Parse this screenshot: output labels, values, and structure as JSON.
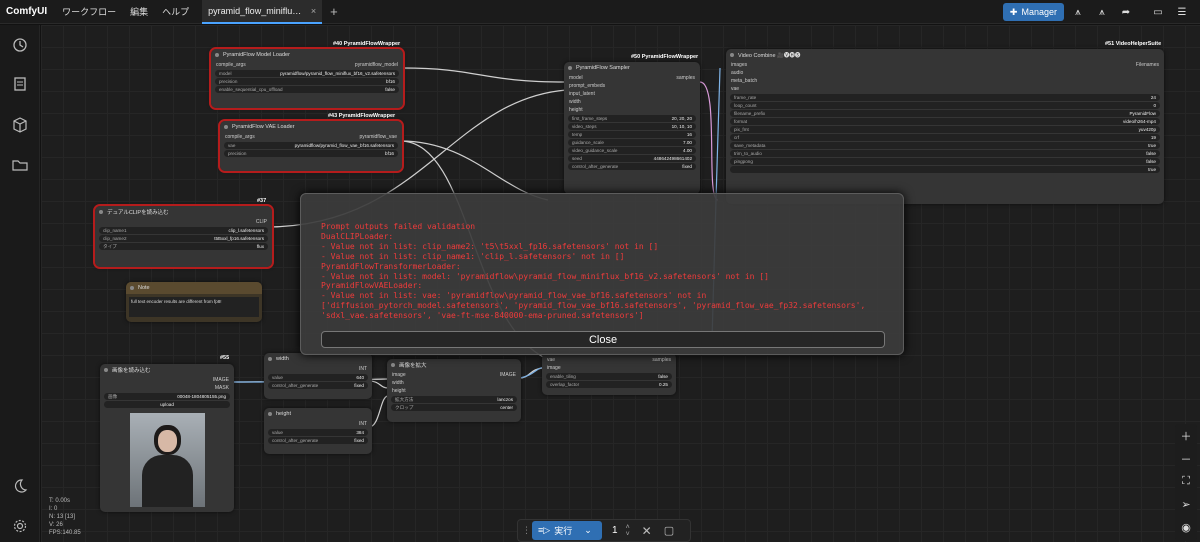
{
  "app": {
    "brand": "ComfyUI"
  },
  "menu": [
    "ワークフロー",
    "編集",
    "ヘルプ"
  ],
  "tab": {
    "label": "pyramid_flow_miniflu…",
    "close": "×",
    "new": "+"
  },
  "topright": {
    "manager_label": "Manager"
  },
  "nodes": {
    "model_loader": {
      "tag": "#40 PyramidFlowWrapper",
      "title": "PyramidFlow Model Loader",
      "in": "compile_args",
      "out": "pyramidflow_model",
      "widgets": [
        [
          "model",
          "pyramidflow/pyramid_flow_miniflux_bf16_v2.safetensors"
        ],
        [
          "precision",
          "bf16"
        ],
        [
          "enable_sequential_cpu_offload",
          "false"
        ]
      ]
    },
    "vae_loader": {
      "tag": "#43 PyramidFlowWrapper",
      "title": "PyramidFlow VAE Loader",
      "in": "compile_args",
      "out": "pyramidflow_vae",
      "widgets": [
        [
          "vae",
          "pyramidflow/pyramid_flow_vae_bf16.safetensors"
        ],
        [
          "precision",
          "bf16"
        ]
      ]
    },
    "sampler": {
      "tag": "#50 PyramidFlowWrapper",
      "title": "PyramidFlow Sampler",
      "inputs": [
        "model",
        "prompt_embeds",
        "input_latent",
        "width",
        "height"
      ],
      "out": "samples",
      "widgets": [
        [
          "first_frame_steps",
          "20, 20, 20"
        ],
        [
          "video_steps",
          "10, 10, 10"
        ],
        [
          "temp",
          "16"
        ],
        [
          "guidance_scale",
          "7.00"
        ],
        [
          "video_guidance_scale",
          "4.00"
        ],
        [
          "seed",
          "448642498661402"
        ],
        [
          "control_after_generate",
          "fixed"
        ]
      ]
    },
    "video_combine": {
      "tag": "#51 VideoHelperSuite",
      "title": "Video Combine 🎥🅥🅗🅢",
      "inputs": [
        "images",
        "audio",
        "meta_batch",
        "vae"
      ],
      "out": "Filenames",
      "widgets": [
        [
          "frame_rate",
          "24"
        ],
        [
          "loop_count",
          "0"
        ],
        [
          "filename_prefix",
          "PyramidFlow"
        ],
        [
          "format",
          "video/h264-mp4"
        ],
        [
          "pix_fmt",
          "yuv420p"
        ],
        [
          "crf",
          "19"
        ],
        [
          "save_metadata",
          "true"
        ],
        [
          "trim_to_audio",
          "false"
        ],
        [
          "pingpong",
          "false"
        ],
        [
          "",
          "true"
        ]
      ]
    },
    "dual_clip": {
      "tag": "#37",
      "title": "デュアルCLIPを読み込む",
      "out": "CLIP",
      "widgets": [
        [
          "clip_name1",
          "clip_l.safetensors"
        ],
        [
          "clip_name2",
          "t5t5xxl_fp16.safetensors"
        ],
        [
          "タイプ",
          "flux"
        ]
      ]
    },
    "note": {
      "title": "Note",
      "text": "full text encoder results are different from fp8!"
    },
    "load_image": {
      "tag": "#55",
      "title": "画像を読み込む",
      "out1": "IMAGE",
      "out2": "MASK",
      "widgets": [
        [
          "画像",
          "00048-1804805155.png"
        ]
      ],
      "upload": "upload"
    },
    "width": {
      "title": "width",
      "out": "INT",
      "widgets": [
        [
          "value",
          "640"
        ],
        [
          "control_after_generate",
          "fixed"
        ]
      ]
    },
    "height": {
      "title": "height",
      "out": "INT",
      "widgets": [
        [
          "value",
          "384"
        ],
        [
          "control_after_generate",
          "fixed"
        ]
      ]
    },
    "upscale": {
      "title": "画像を拡大",
      "inputs": [
        "image",
        "width",
        "height"
      ],
      "out": "IMAGE",
      "widgets": [
        [
          "拡大方法",
          "lanczos"
        ],
        [
          "クロップ",
          "center"
        ]
      ]
    },
    "vae_encode": {
      "inputs": [
        "vae",
        "image"
      ],
      "out": "samples",
      "widgets": [
        [
          "enable_tiling",
          "false"
        ],
        [
          "overlap_factor",
          "0.25"
        ]
      ]
    }
  },
  "error_dialog": {
    "lines": [
      "Prompt outputs failed validation",
      "DualCLIPLoader:",
      "- Value not in list: clip_name2: 't5\\t5xxl_fp16.safetensors' not in []",
      "- Value not in list: clip_name1: 'clip_l.safetensors' not in []",
      "PyramidFlowTransformerLoader:",
      "- Value not in list: model: 'pyramidflow\\pyramid_flow_miniflux_bf16_v2.safetensors' not in []",
      "PyramidFlowVAELoader:",
      "- Value not in list: vae: 'pyramidflow\\pyramid_flow_vae_bf16.safetensors' not in",
      "['diffusion_pytorch_model.safetensors', 'pyramid_flow_vae_bf16.safetensors', 'pyramid_flow_vae_fp32.safetensors',",
      "'sdxl_vae.safetensors', 'vae-ft-mse-840000-ema-pruned.safetensors']"
    ],
    "close_label": "Close"
  },
  "stats": [
    "T: 0.00s",
    "I: 0",
    "N: 13 [13]",
    "V: 26",
    "FPS:140.85"
  ],
  "runbar": {
    "run_label": "実行",
    "count": "1"
  },
  "colors": {
    "accent": "#2f6fb3",
    "error": "#ef3b3b",
    "error_outline": "#b51c1c"
  }
}
